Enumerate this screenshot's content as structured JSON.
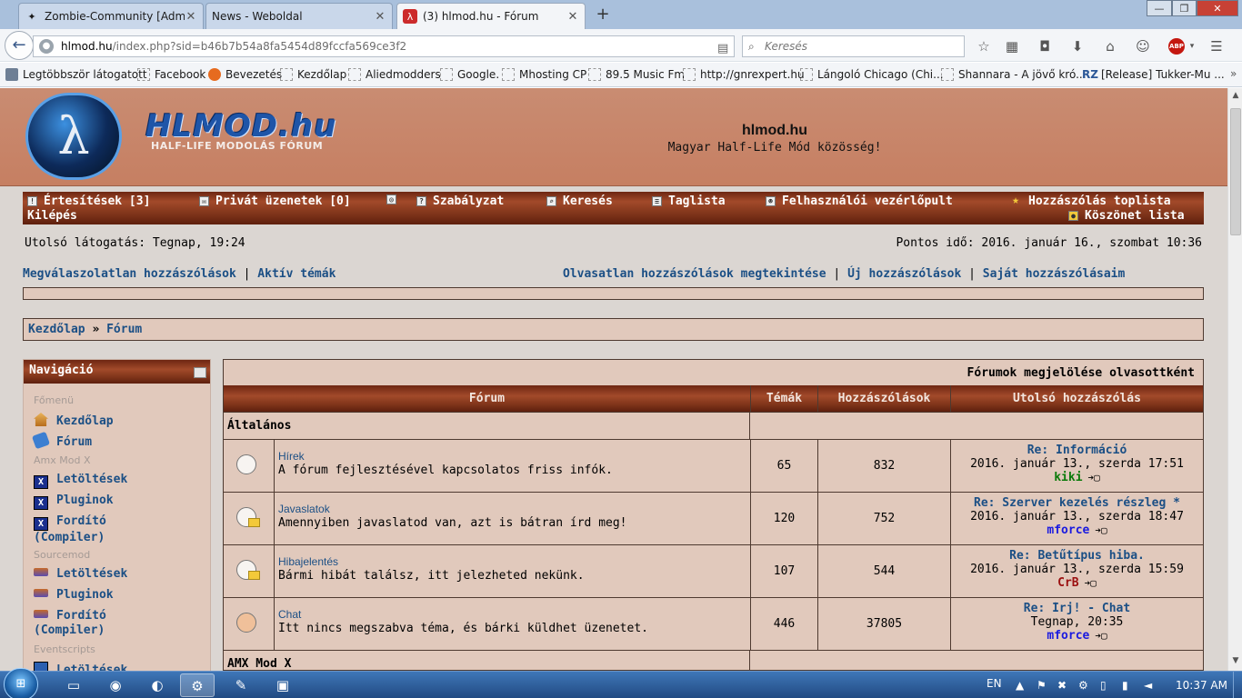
{
  "browser": {
    "tabs": [
      {
        "title": "Zombie-Community [Adm...",
        "icon": "zombie-icon",
        "active": false
      },
      {
        "title": "News - Weboldal",
        "icon": "blank-page-icon",
        "active": false
      },
      {
        "title": "(3) hlmod.hu - Fórum",
        "icon": "hlmod-icon",
        "active": true
      }
    ],
    "new_tab": "+",
    "window_controls": {
      "minimize": "—",
      "maximize": "❐",
      "close": "✕"
    },
    "back": "←",
    "url_host": "hlmod.hu",
    "url_rest": "/index.php?sid=b46b7b54a8fa5454d89fccfa569ce3f2",
    "search_placeholder": "Keresés",
    "bookmarks": [
      {
        "label": "Legtöbbször látogatott",
        "icon": "gear-icon"
      },
      {
        "label": "Facebook",
        "icon": "page-icon"
      },
      {
        "label": "Bevezetés",
        "icon": "firefox-icon"
      },
      {
        "label": "Kezdőlap",
        "icon": "page-icon"
      },
      {
        "label": "Aliedmodders",
        "icon": "page-icon"
      },
      {
        "label": "Google.",
        "icon": "page-icon"
      },
      {
        "label": "Mhosting CP",
        "icon": "page-icon"
      },
      {
        "label": "89.5 Music Fm",
        "icon": "page-icon"
      },
      {
        "label": "http://gnrexpert.hu",
        "icon": "page-icon"
      },
      {
        "label": "Lángoló Chicago (Chi...",
        "icon": "page-icon"
      },
      {
        "label": "Shannara - A jövő kró...",
        "icon": "page-icon"
      },
      {
        "label": "[Release] Tukker-Mu ...",
        "icon": "rz-icon"
      }
    ],
    "bookmarks_more": "»"
  },
  "site": {
    "logo_text": "HLMOD.hu",
    "logo_sub": "HALF-LIFE MODOLÁS FÓRUM",
    "title": "hlmod.hu",
    "tagline": "Magyar Half-Life Mód közösség!"
  },
  "topmenu": {
    "notifications": "Értesítések [3]",
    "pm": "Privát üzenetek [0]",
    "rules": "Szabályzat",
    "search": "Keresés",
    "members": "Taglista",
    "ucp": "Felhasználói vezérlőpult",
    "toplist": "Hozzászólás toplista",
    "logout": "Kilépés",
    "thanks": "Köszönet lista"
  },
  "status": {
    "last_visit": "Utolsó látogatás: Tegnap, 19:24",
    "current_time": "Pontos idő: 2016. január 16., szombat 10:36"
  },
  "quicklinks": {
    "unanswered": "Megválaszolatlan hozzászólások",
    "active": "Aktív témák",
    "unread": "Olvasatlan hozzászólások megtekintése",
    "new": "Új hozzászólások",
    "own": "Saját hozzászólásaim",
    "separator": "|"
  },
  "breadcrumb": {
    "home": "Kezdőlap",
    "sep": "»",
    "forum": "Fórum"
  },
  "sidebar": {
    "title": "Navigáció",
    "sections": {
      "main": "Főmenü",
      "amx": "Amx Mod X",
      "sourcemod": "Sourcemod",
      "eventscripts": "Eventscripts"
    },
    "links": {
      "home": "Kezdőlap",
      "forum": "Fórum",
      "amx_downloads": "Letöltések",
      "amx_plugins": "Pluginok",
      "amx_compiler_1": "Fordító",
      "amx_compiler_2": "(Compiler)",
      "sm_downloads": "Letöltések",
      "sm_plugins": "Pluginok",
      "sm_compiler_1": "Fordító",
      "sm_compiler_2": "(Compiler)",
      "es_downloads": "Letöltések"
    }
  },
  "forum": {
    "mark_read": "Fórumok megjelölése olvasottként",
    "headers": {
      "forum": "Fórum",
      "topics": "Témák",
      "posts": "Hozzászólások",
      "last": "Utolsó hozzászólás"
    },
    "categories": [
      "Általános",
      "AMX Mod X"
    ],
    "rows": [
      {
        "name": "Hírek",
        "desc": "A fórum fejlesztésével kapcsolatos friss infók.",
        "topics": "65",
        "posts": "832",
        "last_title": "Re: Információ",
        "last_date": "2016. január 13., szerda 17:51",
        "last_user": "kiki",
        "user_color": "#0a7a0a",
        "icon": "forum-read-icon"
      },
      {
        "name": "Javaslatok",
        "desc": "Amennyiben javaslatod van, azt is bátran írd meg!",
        "topics": "120",
        "posts": "752",
        "last_title": "Re: Szerver kezelés részleg *",
        "last_date": "2016. január 13., szerda 18:47",
        "last_user": "mforce",
        "user_color": "#1a1ae0",
        "icon": "forum-subforum-icon"
      },
      {
        "name": "Hibajelentés",
        "desc": "Bármi hibát találsz, itt jelezheted nekünk.",
        "topics": "107",
        "posts": "544",
        "last_title": "Re: Betűtípus hiba.",
        "last_date": "2016. január 13., szerda 15:59",
        "last_user": "CrB",
        "user_color": "#9b1010",
        "icon": "forum-subforum-icon"
      },
      {
        "name": "Chat",
        "desc": "Itt nincs megszabva téma, és bárki küldhet üzenetet.",
        "topics": "446",
        "posts": "37805",
        "last_title": "Re: Írj! - Chat",
        "last_date": "Tegnap, 20:35",
        "last_user": "mforce",
        "user_color": "#1a1ae0",
        "icon": "forum-unread-icon"
      }
    ],
    "goto_symbol": "➔▢"
  },
  "taskbar": {
    "start": "⊞",
    "lang": "EN",
    "clock": "10:37 AM"
  }
}
